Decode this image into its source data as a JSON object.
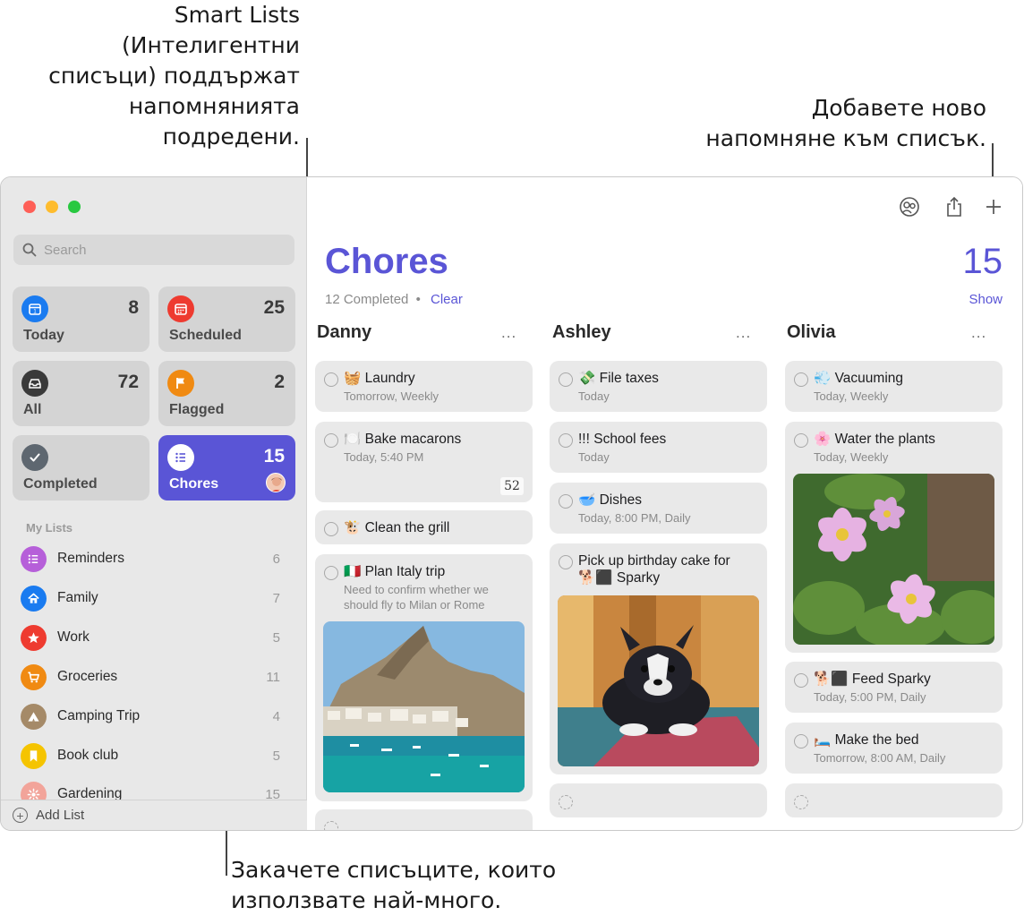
{
  "callouts": {
    "smart_lists": [
      "Smart Lists",
      "(Интелигентни",
      "списъци) поддържат",
      "напомнянията",
      "подредени."
    ],
    "add_reminder": [
      "Добавете ново",
      "напомняне към списък."
    ],
    "pin_lists": [
      "Закачете списъците, които",
      "използвате най-много."
    ]
  },
  "search": {
    "placeholder": "Search"
  },
  "smart_lists": [
    {
      "label": "Today",
      "count": "8",
      "icon": "calendar-icon",
      "color": "#1a7bf0"
    },
    {
      "label": "Scheduled",
      "count": "25",
      "icon": "calendar-grid-icon",
      "color": "#ee3b30"
    },
    {
      "label": "All",
      "count": "72",
      "icon": "tray-icon",
      "color": "#3a3a3a"
    },
    {
      "label": "Flagged",
      "count": "2",
      "icon": "flag-icon",
      "color": "#f08a12"
    },
    {
      "label": "Completed",
      "count": "",
      "icon": "checkmark-icon",
      "color": "#5e6770"
    },
    {
      "label": "Chores",
      "count": "15",
      "icon": "list-icon",
      "color": "#5a55d6"
    }
  ],
  "my_lists_title": "My Lists",
  "my_lists": [
    {
      "name": "Reminders",
      "count": "6",
      "icon": "list-icon",
      "color": "#b65fd9"
    },
    {
      "name": "Family",
      "count": "7",
      "icon": "house-icon",
      "color": "#1a7bf0"
    },
    {
      "name": "Work",
      "count": "5",
      "icon": "star-icon",
      "color": "#ee3b30"
    },
    {
      "name": "Groceries",
      "count": "11",
      "icon": "cart-icon",
      "color": "#f08a12"
    },
    {
      "name": "Camping Trip",
      "count": "4",
      "icon": "tent-icon",
      "color": "#a58a68"
    },
    {
      "name": "Book club",
      "count": "5",
      "icon": "bookmark-icon",
      "color": "#f5c400"
    },
    {
      "name": "Gardening",
      "count": "15",
      "icon": "flower-icon",
      "color": "#f2a49a"
    }
  ],
  "add_list_label": "Add List",
  "main": {
    "title": "Chores",
    "count": "15",
    "completed": "12 Completed",
    "separator": "•",
    "clear": "Clear",
    "show": "Show"
  },
  "columns": [
    {
      "name": "Danny",
      "more": "...",
      "cards": [
        {
          "title": "🧺 Laundry",
          "sub": "Tomorrow, Weekly"
        },
        {
          "title": "🍽️ Bake macarons",
          "sub": "Today, 5:40 PM",
          "badge": "52"
        },
        {
          "title": "🐮 Clean the grill",
          "sub": ""
        },
        {
          "title": "🇮🇹 Plan Italy trip",
          "note": "Need to confirm whether we should fly to Milan or Rome"
        }
      ]
    },
    {
      "name": "Ashley",
      "more": "...",
      "cards": [
        {
          "title": "💸 File taxes",
          "sub": "Today"
        },
        {
          "title": "!!! School fees",
          "sub": "Today"
        },
        {
          "title": "🥣 Dishes",
          "sub": "Today, 8:00 PM, Daily"
        },
        {
          "title": "Pick up birthday cake for 🐕‍⬛ Sparky",
          "sub": ""
        }
      ]
    },
    {
      "name": "Olivia",
      "more": "...",
      "cards": [
        {
          "title": "💨 Vacuuming",
          "sub": "Today, Weekly"
        },
        {
          "title": "🌸 Water the plants",
          "sub": "Today, Weekly"
        },
        {
          "title": "🐕‍⬛ Feed Sparky",
          "sub": "Today, 5:00 PM, Daily"
        },
        {
          "title": "🛏️ Make the bed",
          "sub": "Tomorrow, 8:00 AM, Daily"
        }
      ]
    }
  ]
}
